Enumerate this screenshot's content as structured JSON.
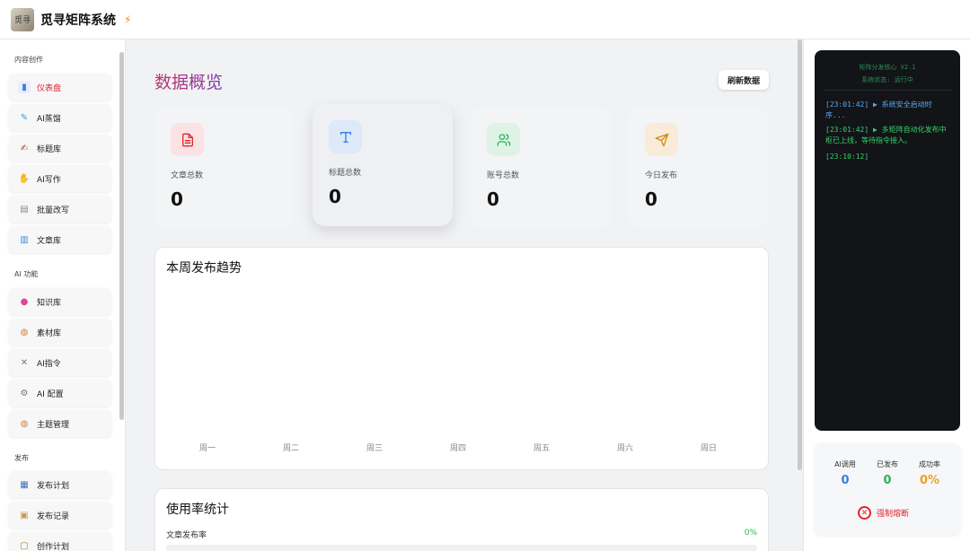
{
  "header": {
    "title": "觅寻矩阵系统",
    "logo_text": "觅寻"
  },
  "sidebar": {
    "sections": [
      {
        "title": "内容创作",
        "items": [
          {
            "label": "仪表盘",
            "icon": "bar-chart-icon",
            "active": true
          },
          {
            "label": "AI蒸馏",
            "icon": "syringe-icon"
          },
          {
            "label": "标题库",
            "icon": "memo-icon"
          },
          {
            "label": "AI写作",
            "icon": "writing-hand-icon"
          },
          {
            "label": "批量改写",
            "icon": "page-icon"
          },
          {
            "label": "文章库",
            "icon": "books-icon"
          }
        ]
      },
      {
        "title": "AI 功能",
        "items": [
          {
            "label": "知识库",
            "icon": "brain-icon"
          },
          {
            "label": "素材库",
            "icon": "palette-icon"
          },
          {
            "label": "AI指令",
            "icon": "wrench-icon"
          },
          {
            "label": "AI 配置",
            "icon": "gear-icon"
          },
          {
            "label": "主题管理",
            "icon": "palette-icon"
          }
        ]
      },
      {
        "title": "发布",
        "items": [
          {
            "label": "发布计划",
            "icon": "calendar-icon"
          },
          {
            "label": "发布记录",
            "icon": "scroll-icon"
          },
          {
            "label": "创作计划",
            "icon": "clipboard-icon"
          }
        ]
      }
    ]
  },
  "main": {
    "title": "数据概览",
    "refresh_label": "刷新数据",
    "stats": [
      {
        "label": "文章总数",
        "value": "0",
        "icon": "document-icon",
        "color": "#e0262f",
        "bg": "#fbe3e4"
      },
      {
        "label": "标题总数",
        "value": "0",
        "icon": "type-icon",
        "color": "#3b7de0",
        "bg": "#dde8f8"
      },
      {
        "label": "账号总数",
        "value": "0",
        "icon": "users-icon",
        "color": "#2db35a",
        "bg": "#def3e5"
      },
      {
        "label": "今日发布",
        "value": "0",
        "icon": "send-icon",
        "color": "#d08a1a",
        "bg": "#f8ecd8"
      }
    ],
    "trend": {
      "title": "本周发布趋势",
      "days": [
        "周一",
        "周二",
        "周三",
        "周四",
        "周五",
        "周六",
        "周日"
      ]
    },
    "usage": {
      "title": "使用率统计",
      "rows": [
        {
          "label": "文章发布率",
          "value": "0%"
        }
      ]
    }
  },
  "console": {
    "title": "矩阵分发核心 V2.1",
    "status": "系统状态: 运行中",
    "logs": [
      {
        "text": "[23:01:42] ▶ 系统安全启动时序...",
        "color": "blue"
      },
      {
        "text": "[23:01:42] ▶ 多矩阵自动化发布中枢已上线，等待指令接入。",
        "color": "green"
      },
      {
        "text": "[23:10:12]",
        "color": "green"
      }
    ]
  },
  "metrics": [
    {
      "label": "AI调用",
      "value": "0",
      "color": "#3b7de0"
    },
    {
      "label": "已发布",
      "value": "0",
      "color": "#2db35a"
    },
    {
      "label": "成功率",
      "value": "0%",
      "color": "#f0a020"
    }
  ],
  "stop_label": "强制熔断"
}
